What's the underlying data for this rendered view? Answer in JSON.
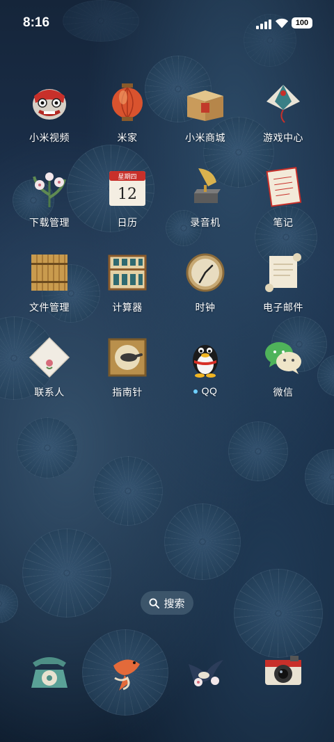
{
  "status_bar": {
    "time": "8:16",
    "battery": "100"
  },
  "apps": [
    {
      "label": "小米视频",
      "name": "app-mi-video",
      "icon": "lion-dance-icon"
    },
    {
      "label": "米家",
      "name": "app-mijia",
      "icon": "lantern-icon"
    },
    {
      "label": "小米商城",
      "name": "app-mi-store",
      "icon": "gift-box-icon"
    },
    {
      "label": "游戏中心",
      "name": "app-game-center",
      "icon": "kite-icon"
    },
    {
      "label": "下载管理",
      "name": "app-downloads",
      "icon": "orchid-icon"
    },
    {
      "label": "日历",
      "name": "app-calendar",
      "icon": "calendar-icon",
      "day": "12",
      "weekday": "星期四"
    },
    {
      "label": "录音机",
      "name": "app-recorder",
      "icon": "gramophone-icon"
    },
    {
      "label": "笔记",
      "name": "app-notes",
      "icon": "letter-paper-icon"
    },
    {
      "label": "文件管理",
      "name": "app-file-manager",
      "icon": "bamboo-scroll-icon"
    },
    {
      "label": "计算器",
      "name": "app-calculator",
      "icon": "abacus-icon"
    },
    {
      "label": "时钟",
      "name": "app-clock",
      "icon": "clock-icon"
    },
    {
      "label": "电子邮件",
      "name": "app-email",
      "icon": "paper-scroll-icon"
    },
    {
      "label": "联系人",
      "name": "app-contacts",
      "icon": "handkerchief-icon"
    },
    {
      "label": "指南针",
      "name": "app-compass",
      "icon": "compass-icon"
    },
    {
      "label": "QQ",
      "name": "app-qq",
      "icon": "qq-penguin-icon",
      "new_indicator": true
    },
    {
      "label": "微信",
      "name": "app-wechat",
      "icon": "wechat-icon"
    }
  ],
  "search": {
    "label": "搜索"
  },
  "dock": [
    {
      "name": "dock-phone",
      "icon": "rotary-phone-icon"
    },
    {
      "name": "dock-messages",
      "icon": "koi-fish-icon"
    },
    {
      "name": "dock-browser",
      "icon": "swallow-bird-icon"
    },
    {
      "name": "dock-camera",
      "icon": "camera-icon"
    }
  ]
}
